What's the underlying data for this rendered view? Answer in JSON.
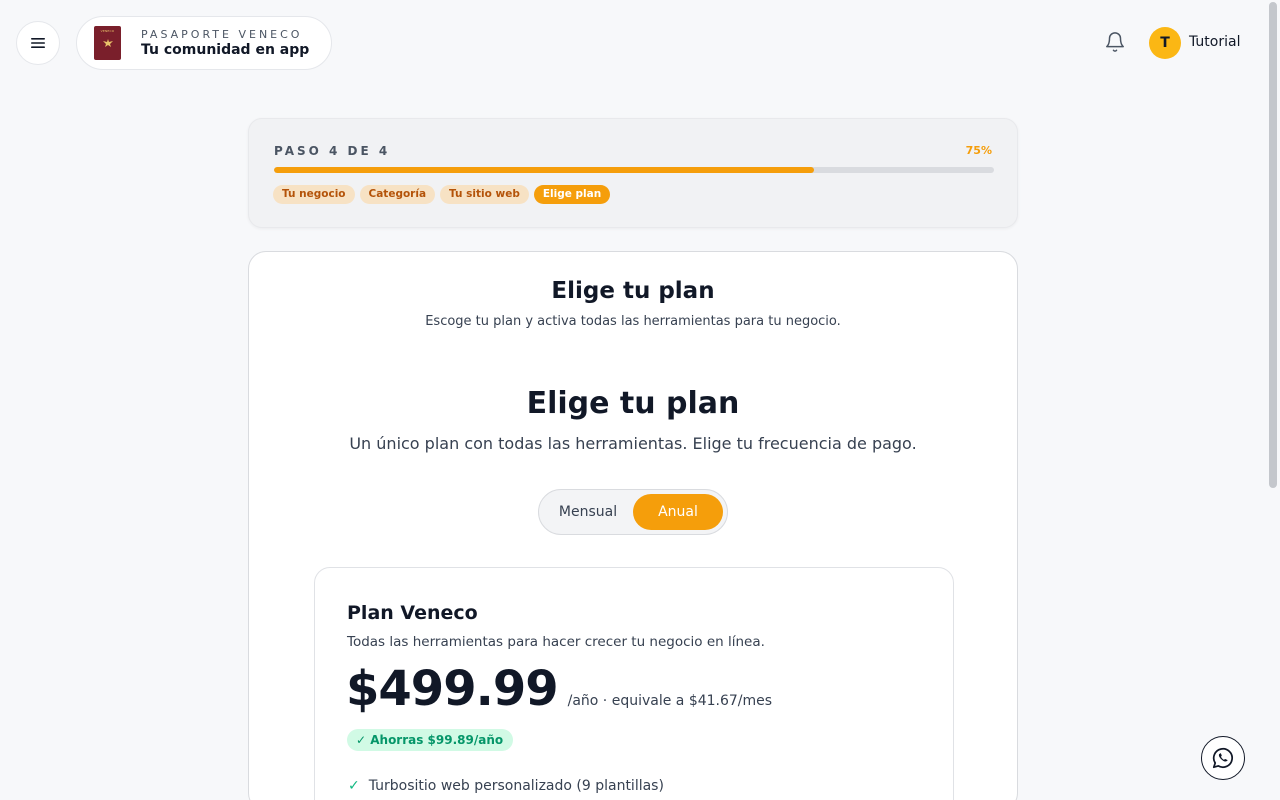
{
  "header": {
    "brand_kicker": "PASAPORTE VENECO",
    "brand_title": "Tu comunidad en app",
    "passport_label": "VENECO",
    "avatar_initial": "T",
    "username": "Tutorial",
    "icons": {
      "menu": "hamburger-icon",
      "bell": "bell-icon"
    }
  },
  "progress": {
    "step_label": "PASO 4 DE 4",
    "percent_label": "75%",
    "percent": 75,
    "steps": [
      {
        "label": "Tu negocio",
        "active": false
      },
      {
        "label": "Categoría",
        "active": false
      },
      {
        "label": "Tu sitio web",
        "active": false
      },
      {
        "label": "Elige plan",
        "active": true
      }
    ]
  },
  "main": {
    "title": "Elige tu plan",
    "subtitle": "Escoge tu plan y activa todas las herramientas para tu negocio.",
    "section_title": "Elige tu plan",
    "section_subtitle": "Un único plan con todas las herramientas. Elige tu frecuencia de pago.",
    "billing_toggle": {
      "options": [
        "Mensual",
        "Anual"
      ],
      "selected": "Anual"
    },
    "plan": {
      "name": "Plan Veneco",
      "description": "Todas las herramientas para hacer crecer tu negocio en línea.",
      "price": "$499.99",
      "price_note": "/año · equivale a $41.67/mes",
      "savings": "✓ Ahorras $99.89/año",
      "features": [
        "Turbositio web personalizado (9 plantillas)"
      ]
    }
  },
  "floating": {
    "whatsapp_icon": "whatsapp-icon"
  },
  "colors": {
    "accent": "#f59e0b",
    "avatar": "#fbb714",
    "success": "#10b981",
    "passport": "#7a1f2b"
  }
}
